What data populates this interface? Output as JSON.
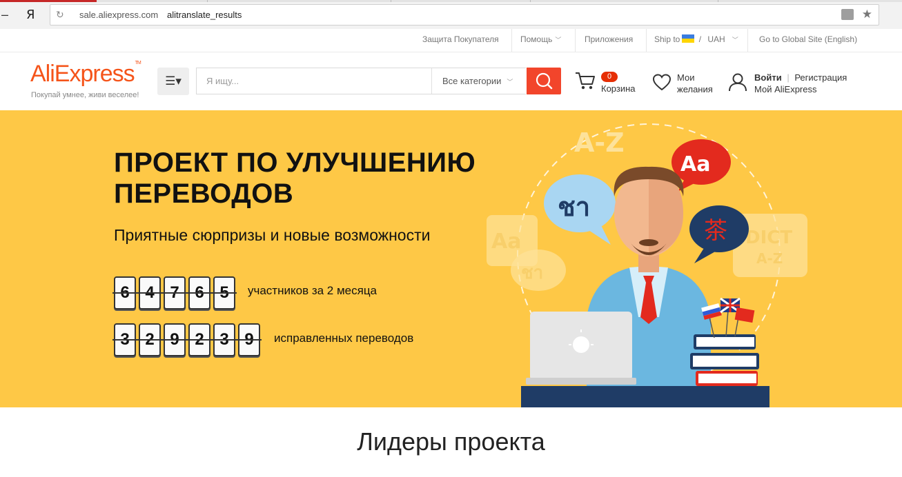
{
  "browser": {
    "logo": "Я",
    "domain": "sale.aliexpress.com",
    "path": "alitranslate_results"
  },
  "toplinks": {
    "buyer_protection": "Защита Покупателя",
    "help": "Помощь",
    "apps": "Приложения",
    "ship_to": "Ship to",
    "currency": "UAH",
    "global_site": "Go to Global Site (English)"
  },
  "header": {
    "logo": "AliExpress",
    "slogan": "Покупай умнее, живи веселее!",
    "search_placeholder": "Я ищу...",
    "category_select": "Все категории",
    "cart_count": "0",
    "cart_label": "Корзина",
    "wishlist_line1": "Мои",
    "wishlist_line2": "желания",
    "login": "Войти",
    "register": "Регистрация",
    "my_account": "Мой AliExpress"
  },
  "banner": {
    "title_line1": "ПРОЕКТ ПО УЛУЧШЕНИЮ",
    "title_line2": "ПЕРЕВОДОВ",
    "subtitle": "Приятные сюрпризы и новые возможности",
    "participants_digits": [
      "6",
      "4",
      "7",
      "6",
      "5"
    ],
    "participants_label": "участников за 2 месяца",
    "translations_digits": [
      "3",
      "2",
      "9",
      "2",
      "3",
      "9"
    ],
    "translations_label": "исправленных переводов",
    "illustration_text": {
      "az": "A-Z",
      "aa": "Aa",
      "thai": "ชา",
      "cn": "茶",
      "dict": "DICT",
      "az2": "A-Z"
    }
  },
  "section": {
    "leaders_title": "Лидеры проекта"
  },
  "colors": {
    "brand": "#f5541a",
    "search_button": "#f2452b",
    "banner_bg": "#fec846"
  }
}
